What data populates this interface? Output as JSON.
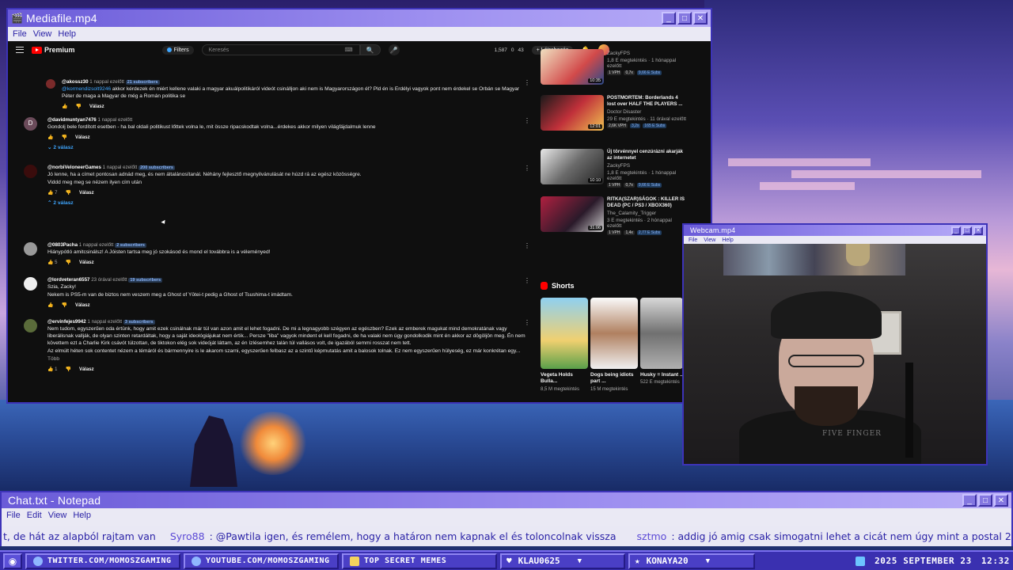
{
  "media_window": {
    "title": "Mediafile.mp4",
    "menu": [
      "File",
      "View",
      "Help"
    ]
  },
  "youtube": {
    "logo": "Premium",
    "filters_label": "Filters",
    "search_placeholder": "Keresés",
    "stats": [
      "1,587",
      "0",
      "43"
    ],
    "create_label": "Létrehozás"
  },
  "comments": [
    {
      "name": "@akossz30",
      "time": "1 nappal ezelőtt",
      "subs": "21 subscribers",
      "text_pre": "",
      "mention": "@kormendizsolt9246",
      "text": " akkor kérdezek én miért kellene valaki a magyar akuálpolitikáról videót csinálljon aki nem is Magyarországon él? Pld én is Erdélyi vagyok pont nem érdekel se Orbán se Magyar Péter de maga a Magyar de még a Román politika se",
      "reply": "Válasz"
    },
    {
      "avatar": "D",
      "name": "@davidmuntyan7476",
      "time": "1 nappal ezelőtt",
      "text": "Gondolj bele fordított esetben - ha bal oldali politikust lőttek volna le, mit össze ripacskodtak volna...érdekes akkor milyen világfájdalmuk lenne",
      "reply": "Válasz",
      "replies": "2 válasz"
    },
    {
      "name": "@norbiVeloneerGames",
      "time": "1 nappal ezelőtt",
      "subs": "200 subscribers",
      "text": "Jó lenne, ha a címet pontosan adnád meg, és nem általánosítanál. Néhány fejlesztő megnyilvánulását ne húzd rá az egész közösségre.",
      "text2": "Viddd meg meg se nézem ilyen cím után",
      "likes": "7",
      "reply": "Válasz",
      "replies": "2 válasz"
    },
    {
      "name": "@0803Pacha",
      "time": "1 nappal ezelőtt",
      "subs": "2 subscribers",
      "text": "Hiánypótló amitcsinálsz! A Jóisten tartsa meg jó szokásod és mond el továbbra is a véleményed!",
      "likes": "5",
      "reply": "Válasz"
    },
    {
      "name": "@lordveteran6557",
      "time": "23 órával ezelőtt",
      "subs": "19 subscribers",
      "text": "Szia, Zacky!",
      "text2": "Nekem is PS5-m van de biztos nem veszem meg a Ghost of Yōtei-t pedig a Ghost of Tsushima-t imádtam.",
      "reply": "Válasz"
    },
    {
      "name": "@ervinfejes9942",
      "time": "1 nappal ezelőtt",
      "subs": "3 subscribers",
      "text": "Nem tudom, egyszerűen oda értünk, hogy amit ezek csinálnak már túl van azon amit el lehet fogadni. De mi a legnagyobb szégyen az egészben? Ezek az emberek magukat mind demokratának vagy liberálisnak vallják, de olyan szinten retardáltak, hogy a saját ideológiájukat nem értik... Persze \"liba\" vagyok mindent el kell fogadni, de ha valaki nem úgy gondolkodik mint én akkor az dögöljön meg. Én nem követtem ezt a Charlie Kirk csávót túlzottan, de tiktokon elég sok videóját láttam, az én ízlésemhez talán túl vallásos volt, de igazából semmi rosszat nem tett.",
      "text2": "Az elmúlt héten sok contentet nézem a témáról és bármennyire is le akarom szarni, egyszerűen felbasz az a szintű képmutatás amit a balosok tolnak. Ez nem egyszerűen hülyeség, ez már konkrétan egy...",
      "more": "Több",
      "likes": "1",
      "reply": "Válasz"
    }
  ],
  "sidebar_videos": [
    {
      "title": "ZackyFPS",
      "channel": "1,8 E megtekintés · 1 hónappal ezelőtt",
      "tags": [
        "1 VPH",
        "0,7x",
        "9,66 E Subs"
      ],
      "duration": "10:35"
    },
    {
      "title": "POSTMORTEM: Borderlands 4 lost over HALF THE PLAYERS ...",
      "channel": "Doctor Disaster",
      "views": "29 E megtekintés · 11 órával ezelőtt",
      "tags": [
        "2,6K VPH",
        "3,2x",
        "165 E Subs"
      ],
      "duration": "12:01"
    },
    {
      "title": "Új törvénnyel cenzúrázni akarják az internetet",
      "channel": "ZackyFPS",
      "views": "1,8 E megtekintés · 1 hónappal ezelőtt",
      "tags": [
        "1 VPH",
        "0,7x",
        "9,66 E Subs"
      ],
      "duration": "10:10"
    },
    {
      "title": "RITKA(SZAR)SÁGOK : KILLER IS DEAD (PC / PS3 / XBOX360)",
      "channel": "The_Calamity_Trigger",
      "views": "3 E megtekintés · 2 hónappal ezelőtt",
      "tags": [
        "1 VPH",
        "1,4x",
        "2,77 E Subs"
      ],
      "duration": "31:06"
    }
  ],
  "shorts": {
    "heading": "Shorts",
    "items": [
      {
        "title": "Vegeta Holds Bulla...",
        "views": "8,5 M megtekintés"
      },
      {
        "title": "Dogs being idiots part ...",
        "views": "15 M megtekintés"
      },
      {
        "title": "Husky = Instant ...",
        "views": "522 E megtekintés"
      }
    ]
  },
  "webcam_window": {
    "title": "Webcam.mp4",
    "menu": [
      "File",
      "View",
      "Help"
    ],
    "shirt_text": "FIVE FINGER"
  },
  "chat_window": {
    "title": "Chat.txt - Notepad",
    "menu": [
      "File",
      "Edit",
      "View",
      "Help"
    ],
    "msg1": "t, de hát az alapból rajtam van",
    "user2": "Syro88",
    "msg2": ": @Pawtila igen, és remélem, hogy a határon nem kapnak el és toloncolnak vissza",
    "user3": "sztmo",
    "msg3": ": addig jó amig csak simogatni lehet a cicát nem úgy mint a postal 2 ben"
  },
  "taskbar": {
    "items": [
      "TWITTER.COM/MOMOSZGAMING",
      "YOUTUBE.COM/MOMOSZGAMING",
      "TOP SECRET MEMES"
    ],
    "drop1": "KLAU0625",
    "drop2": "KONAYA20",
    "date": "2025 SEPTEMBER 23",
    "time": "12:32"
  },
  "colors": {
    "window_border": "#3d33b8",
    "title_gradient_start": "#6a5bd8",
    "taskbar": "#3a30b0",
    "chat_text": "#2a22a6",
    "yt_bg": "#0f0f0f"
  }
}
